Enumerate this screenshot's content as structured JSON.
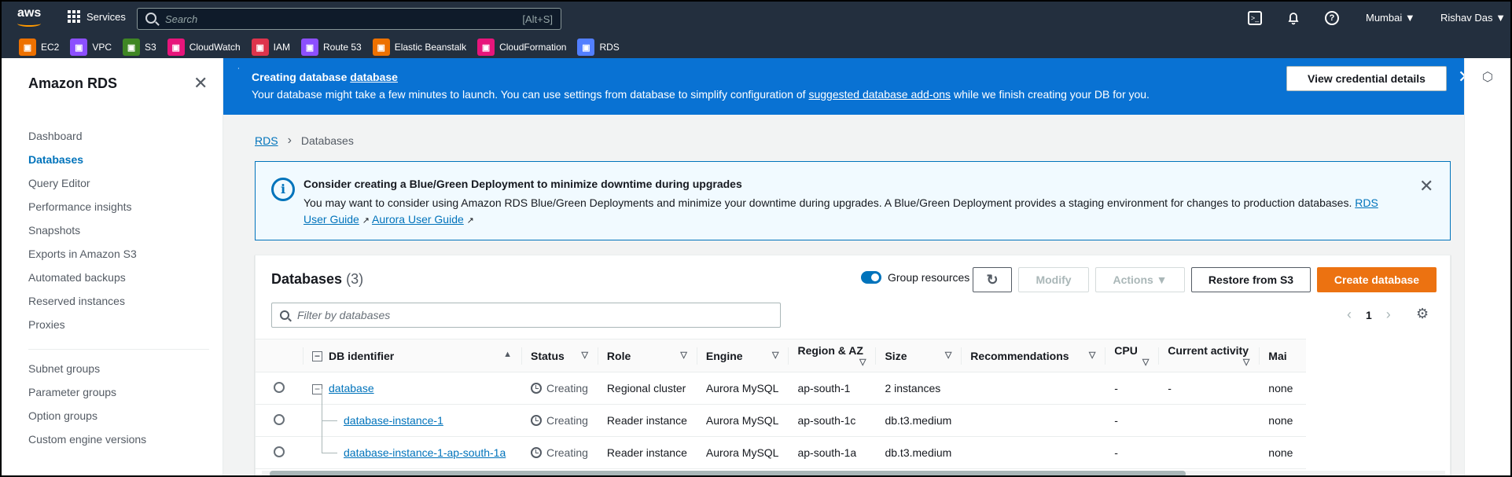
{
  "topnav": {
    "logo": "aws",
    "services_label": "Services",
    "search_placeholder": "Search",
    "search_shortcut": "[Alt+S]",
    "region": "Mumbai ▼",
    "user": "Rishav Das ▼",
    "favorites": [
      {
        "label": "EC2",
        "icon": "ec2-icon",
        "color": "#ed7100"
      },
      {
        "label": "VPC",
        "icon": "vpc-icon",
        "color": "#8c4fff"
      },
      {
        "label": "S3",
        "icon": "s3-icon",
        "color": "#3f8624"
      },
      {
        "label": "CloudWatch",
        "icon": "cloudwatch-icon",
        "color": "#e7157b"
      },
      {
        "label": "IAM",
        "icon": "iam-icon",
        "color": "#dd344c"
      },
      {
        "label": "Route 53",
        "icon": "route53-icon",
        "color": "#8c4fff"
      },
      {
        "label": "Elastic Beanstalk",
        "icon": "elastic-beanstalk-icon",
        "color": "#ed7100"
      },
      {
        "label": "CloudFormation",
        "icon": "cloudformation-icon",
        "color": "#e7157b"
      },
      {
        "label": "RDS",
        "icon": "rds-icon",
        "color": "#527fff"
      }
    ]
  },
  "sidebar": {
    "title": "Amazon RDS",
    "items": [
      "Dashboard",
      "Databases",
      "Query Editor",
      "Performance insights",
      "Snapshots",
      "Exports in Amazon S3",
      "Automated backups",
      "Reserved instances",
      "Proxies"
    ],
    "active": "Databases",
    "items2": [
      "Subnet groups",
      "Parameter groups",
      "Option groups",
      "Custom engine versions"
    ]
  },
  "flash": {
    "title_prefix": "Creating database ",
    "title_link": "database",
    "body_prefix": "Your database might take a few minutes to launch. You can use settings from database to simplify configuration of ",
    "body_link": "suggested database add-ons",
    "body_suffix": " while we finish creating your DB for you.",
    "button": "View credential details",
    "color": "#0972d3"
  },
  "breadcrumb": {
    "root": "RDS",
    "current": "Databases"
  },
  "info": {
    "title": "Consider creating a Blue/Green Deployment to minimize downtime during upgrades",
    "body": "You may want to consider using Amazon RDS Blue/Green Deployments and minimize your downtime during upgrades. A Blue/Green Deployment provides a staging environment for changes to production databases. ",
    "link1": "RDS User Guide",
    "link2": "Aurora User Guide"
  },
  "panel": {
    "title": "Databases",
    "count": "(3)",
    "group_toggle": "Group resources",
    "modify": "Modify",
    "actions": "Actions ▼",
    "restore": "Restore from S3",
    "create": "Create database",
    "filter_placeholder": "Filter by databases",
    "page": "1",
    "accent": "#ec7211"
  },
  "table": {
    "columns": [
      "DB identifier",
      "Status",
      "Role",
      "Engine",
      "Region & AZ",
      "Size",
      "Recommendations",
      "CPU",
      "Current activity",
      "Mai"
    ],
    "rows": [
      {
        "id": "database",
        "status": "Creating",
        "role": "Regional cluster",
        "engine": "Aurora MySQL",
        "region": "ap-south-1",
        "size": "2 instances",
        "recommendations": "",
        "cpu": "-",
        "activity": "-",
        "maint": "none"
      },
      {
        "id": "database-instance-1",
        "status": "Creating",
        "role": "Reader instance",
        "engine": "Aurora MySQL",
        "region": "ap-south-1c",
        "size": "db.t3.medium",
        "recommendations": "",
        "cpu": "-",
        "activity": "",
        "maint": "none"
      },
      {
        "id": "database-instance-1-ap-south-1a",
        "status": "Creating",
        "role": "Reader instance",
        "engine": "Aurora MySQL",
        "region": "ap-south-1a",
        "size": "db.t3.medium",
        "recommendations": "",
        "cpu": "-",
        "activity": "",
        "maint": "none"
      }
    ]
  }
}
